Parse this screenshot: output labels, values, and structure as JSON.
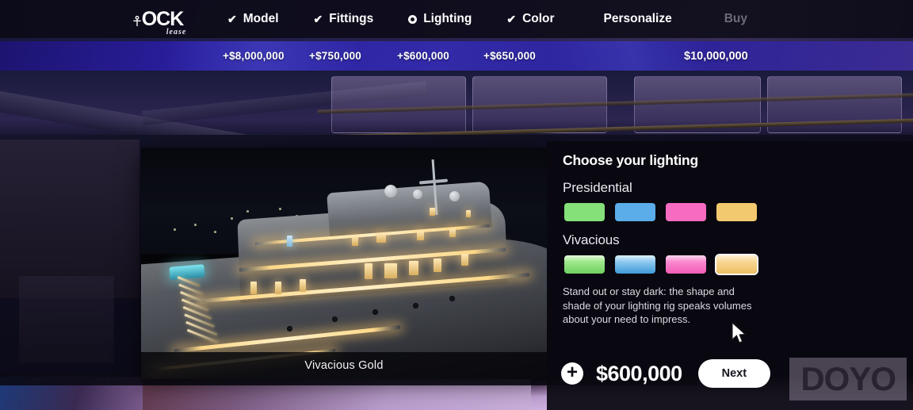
{
  "brand": {
    "word": "OCK",
    "sub": "lease",
    "anchor_icon": "anchor-icon"
  },
  "nav": {
    "items": [
      {
        "label": "Model",
        "state": "done",
        "icon": "check-icon"
      },
      {
        "label": "Fittings",
        "state": "done",
        "icon": "check-icon"
      },
      {
        "label": "Lighting",
        "state": "current",
        "icon": "radio-icon"
      },
      {
        "label": "Color",
        "state": "done",
        "icon": "check-icon"
      },
      {
        "label": "Personalize",
        "state": "pending",
        "icon": ""
      },
      {
        "label": "Buy",
        "state": "disabled",
        "icon": ""
      }
    ]
  },
  "pricebar": {
    "steps": [
      "+$8,000,000",
      "+$750,000",
      "+$600,000",
      "+$650,000"
    ],
    "total": "$10,000,000",
    "color": "#2a1fa0"
  },
  "preview": {
    "caption": "Vivacious Gold"
  },
  "panel": {
    "title": "Choose your lighting",
    "groups": [
      {
        "label": "Presidential",
        "swatches": [
          {
            "name": "green",
            "color": "#86e07a",
            "selected": false
          },
          {
            "name": "blue",
            "color": "#5aade8",
            "selected": false
          },
          {
            "name": "pink",
            "color": "#f76bc0",
            "selected": false
          },
          {
            "name": "gold",
            "color": "#f3c96f",
            "selected": false
          }
        ]
      },
      {
        "label": "Vivacious",
        "swatches": [
          {
            "name": "green",
            "color": "#86e07a",
            "selected": false
          },
          {
            "name": "blue",
            "color": "#5aade8",
            "selected": false
          },
          {
            "name": "pink",
            "color": "#f76bc0",
            "selected": false
          },
          {
            "name": "gold",
            "color": "#f3c96f",
            "selected": true
          }
        ]
      }
    ],
    "description": "Stand out or stay dark: the shape and shade of your lighting rig speaks volumes about your need to impress."
  },
  "action": {
    "plus": "+",
    "price": "$600,000",
    "next_label": "Next"
  },
  "watermark": {
    "text": "DOYO"
  }
}
